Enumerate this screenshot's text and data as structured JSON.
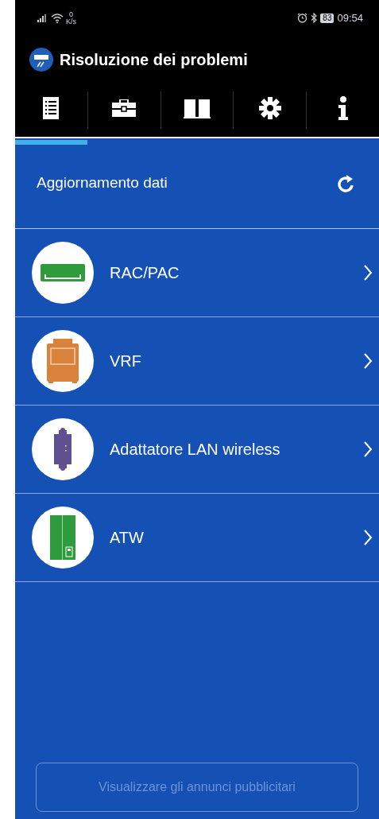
{
  "status_bar": {
    "network_speed_value": "0",
    "network_speed_unit": "K/s",
    "battery": "83",
    "time": "09:54"
  },
  "app_bar": {
    "title": "Risoluzione dei problemi"
  },
  "tabs": [
    {
      "kind": "list",
      "selected": true
    },
    {
      "kind": "toolbox",
      "selected": false
    },
    {
      "kind": "book",
      "selected": false
    },
    {
      "kind": "gear",
      "selected": false
    },
    {
      "kind": "info",
      "selected": false
    }
  ],
  "refresh_row": {
    "label": "Aggiornamento dati"
  },
  "items": [
    {
      "kind": "split",
      "label": "RAC/PAC",
      "color": "#2e9c3a"
    },
    {
      "kind": "vrf",
      "label": "VRF",
      "color": "#d9823b"
    },
    {
      "kind": "adapter",
      "label": "Adattatore LAN wireless",
      "color": "#5f5090"
    },
    {
      "kind": "atw",
      "label": "ATW",
      "color": "#2e9c3a"
    }
  ],
  "ads_button": {
    "label": "Visualizzare gli annunci pubblicitari",
    "disabled": true
  }
}
